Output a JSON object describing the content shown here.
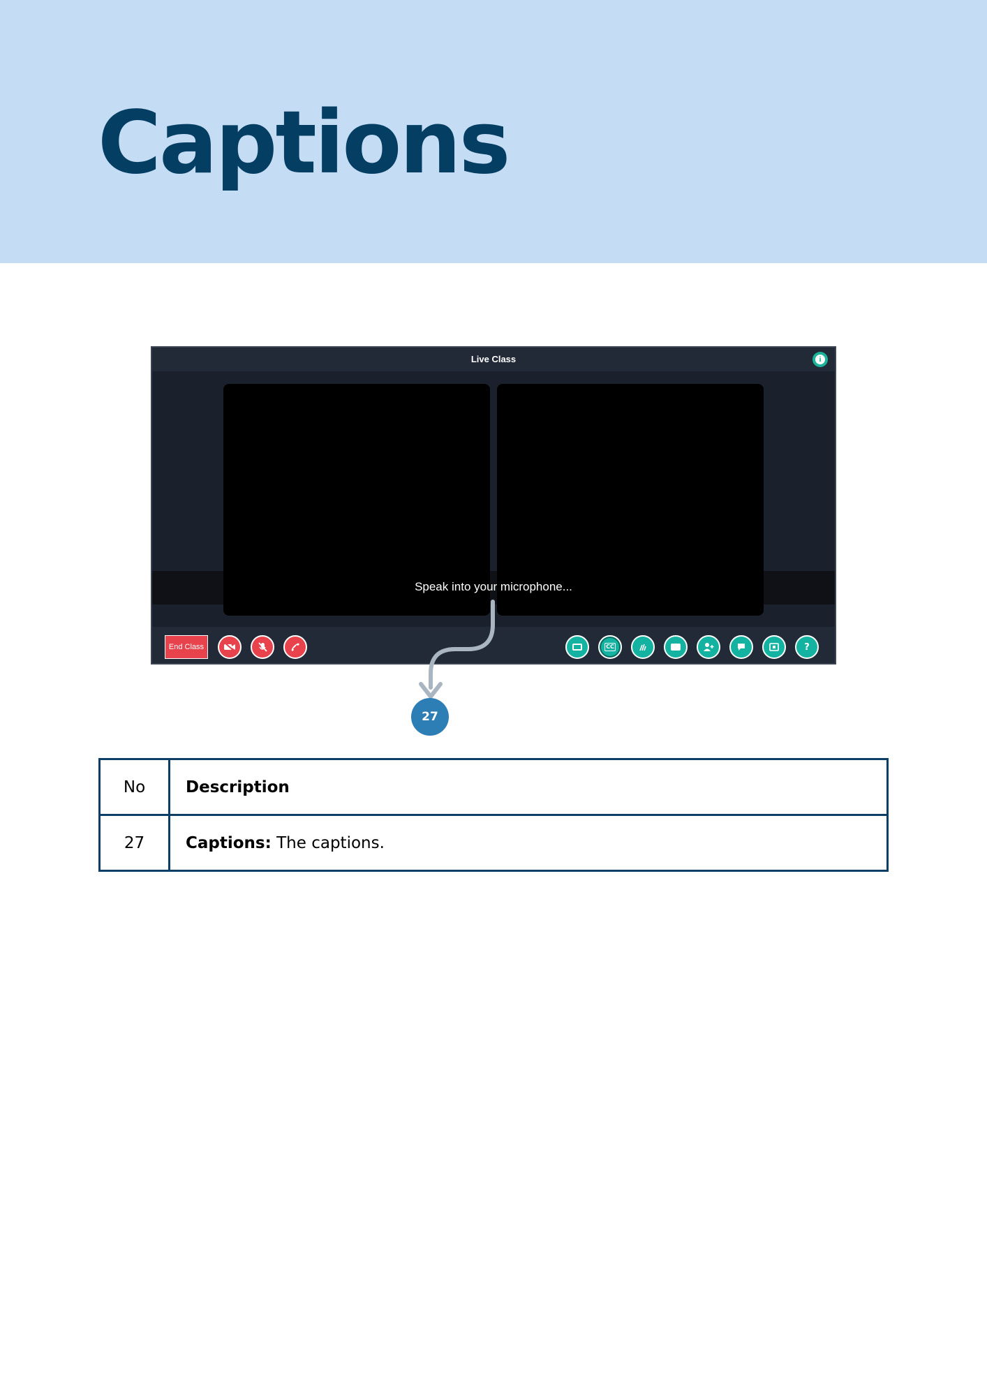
{
  "page": {
    "title": "Captions"
  },
  "app": {
    "window_title": "Live Class",
    "caption_text": "Speak into your microphone...",
    "end_class_label": "End Class",
    "left_controls": [
      "camera-off-icon",
      "mic-off-icon",
      "end-call-icon"
    ],
    "right_controls": [
      "picture-in-picture-icon",
      "captions-icon",
      "sign-language-icon",
      "whiteboard-icon",
      "add-participant-icon",
      "chat-icon",
      "screen-share-icon",
      "help-icon"
    ],
    "colors": {
      "control_red": "#e8424c",
      "control_teal": "#14b2a0",
      "background": "#1a202c"
    }
  },
  "callout": {
    "number": "27"
  },
  "table": {
    "header": {
      "no": "No",
      "description": "Description"
    },
    "rows": [
      {
        "no": "27",
        "term": "Captions:",
        "text": " The captions."
      }
    ]
  },
  "colors": {
    "header_band": "#c4ddf4",
    "title": "#053e63",
    "table_border": "#0c3e66",
    "marker": "#2e7eb6"
  }
}
